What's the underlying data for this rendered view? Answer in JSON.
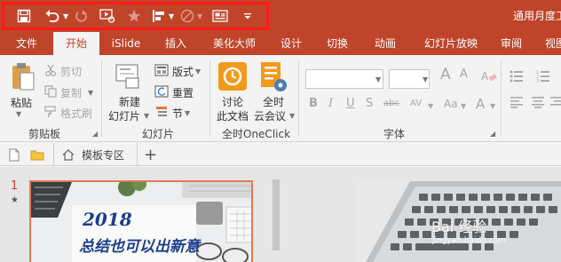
{
  "title": "通用月度工",
  "qat": {
    "save": "save-icon",
    "undo": "undo-icon",
    "redo": "redo-icon",
    "from_start": "play-from-start-icon",
    "star": "star-icon",
    "align": "align-icon",
    "shape": "shape-icon",
    "textbox": "textbox-icon",
    "customize": "customize-qat-icon"
  },
  "tabs": [
    "文件",
    "开始",
    "iSlide",
    "插入",
    "美化大师",
    "设计",
    "切换",
    "动画",
    "幻灯片放映",
    "审阅",
    "视图"
  ],
  "active_tab": "开始",
  "ribbon": {
    "clipboard": {
      "label": "剪贴板",
      "paste": "粘贴",
      "cut": "剪切",
      "copy": "复制",
      "format_painter": "格式刷"
    },
    "slides": {
      "label": "幻灯片",
      "new_slide_1": "新建",
      "new_slide_2": "幻灯片",
      "layout": "版式",
      "reset": "重置",
      "section": "节"
    },
    "oneclick": {
      "label": "全时OneClick",
      "discuss_1": "讨论",
      "discuss_2": "此文档",
      "meeting_1": "全时",
      "meeting_2": "云会议"
    },
    "font": {
      "label": "字体",
      "bold": "B",
      "italic": "I",
      "underline": "U",
      "shadow": "S",
      "strike": "abc",
      "spacing": "AV",
      "case": "Aa",
      "font_a": "A"
    }
  },
  "doc_tabs": {
    "template": "模板专区",
    "add": "+"
  },
  "slides_panel": {
    "number": "1",
    "star": "★",
    "thumb_line1": "2018",
    "thumb_line2": "总结也可以出新意"
  },
  "watermark": {
    "main": "Bai 经验",
    "sub": "jingyan.baidu.com"
  },
  "colors": {
    "accent": "#c0442a",
    "qat_highlight": "#ff1a1a"
  }
}
